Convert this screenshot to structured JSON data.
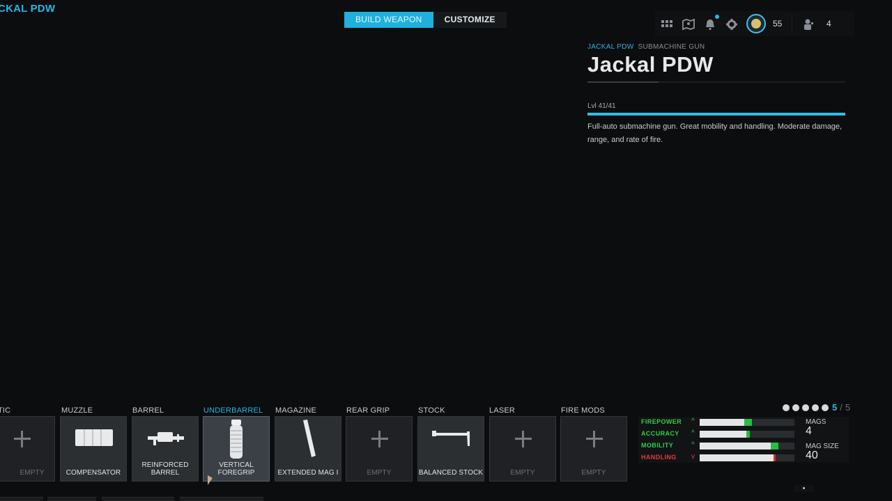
{
  "top_title": "ACKAL PDW",
  "tabs": [
    {
      "label": "BUILD WEAPON",
      "active": true
    },
    {
      "label": "CUSTOMIZE",
      "active": false
    }
  ],
  "hud": {
    "icons": [
      "grid-icon",
      "map-icon",
      "bell-icon",
      "gear-icon",
      "rank-badge-icon",
      "party-icon"
    ],
    "level": "55",
    "party_count": "4",
    "accent": "#2cb8ea"
  },
  "weapon": {
    "name_tag": "JACKAL PDW",
    "class_tag": "SUBMACHINE GUN",
    "title": "Jackal PDW",
    "level_text": "Lvl 41/41",
    "level_progress": 1.0,
    "description": "Full-auto submachine gun.  Great mobility and handling. Moderate damage, range, and rate of fire."
  },
  "attachments": [
    {
      "category": "TIC",
      "name": "EMPTY",
      "empty": true,
      "selected": false
    },
    {
      "category": "MUZZLE",
      "name": "COMPENSATOR",
      "empty": false,
      "selected": false,
      "icon": "compensator-icon"
    },
    {
      "category": "BARREL",
      "name": "REINFORCED BARREL",
      "empty": false,
      "selected": false,
      "icon": "barrel-icon"
    },
    {
      "category": "UNDERBARREL",
      "name": "VERTICAL FOREGRIP",
      "empty": false,
      "selected": true,
      "icon": "foregrip-icon"
    },
    {
      "category": "MAGAZINE",
      "name": "EXTENDED MAG I",
      "empty": false,
      "selected": false,
      "icon": "magazine-icon"
    },
    {
      "category": "REAR GRIP",
      "name": "EMPTY",
      "empty": true,
      "selected": false
    },
    {
      "category": "STOCK",
      "name": "BALANCED STOCK",
      "empty": false,
      "selected": false,
      "icon": "stock-icon"
    },
    {
      "category": "LASER",
      "name": "EMPTY",
      "empty": true,
      "selected": false
    },
    {
      "category": "FIRE MODS",
      "name": "EMPTY",
      "empty": true,
      "selected": false
    }
  ],
  "pagination": {
    "current": "5",
    "separator": "/",
    "total": "5",
    "dots": 5
  },
  "stats": [
    {
      "name": "FIREPOWER",
      "arrow": "^",
      "positive": true,
      "base": 0.47,
      "delta": 0.08
    },
    {
      "name": "ACCURACY",
      "arrow": "^",
      "positive": true,
      "base": 0.49,
      "delta": 0.04
    },
    {
      "name": "MOBILITY",
      "arrow": "^",
      "positive": true,
      "base": 0.75,
      "delta": 0.08
    },
    {
      "name": "HANDLING",
      "arrow": "v",
      "positive": false,
      "base": 0.78,
      "delta": 0.02
    }
  ],
  "meta_stats": [
    {
      "label": "MAGS",
      "value": "4"
    },
    {
      "label": "MAG SIZE",
      "value": "40"
    }
  ],
  "colors": {
    "accent": "#28b4e8",
    "positive": "#30d04a",
    "negative": "#e43c3c"
  }
}
